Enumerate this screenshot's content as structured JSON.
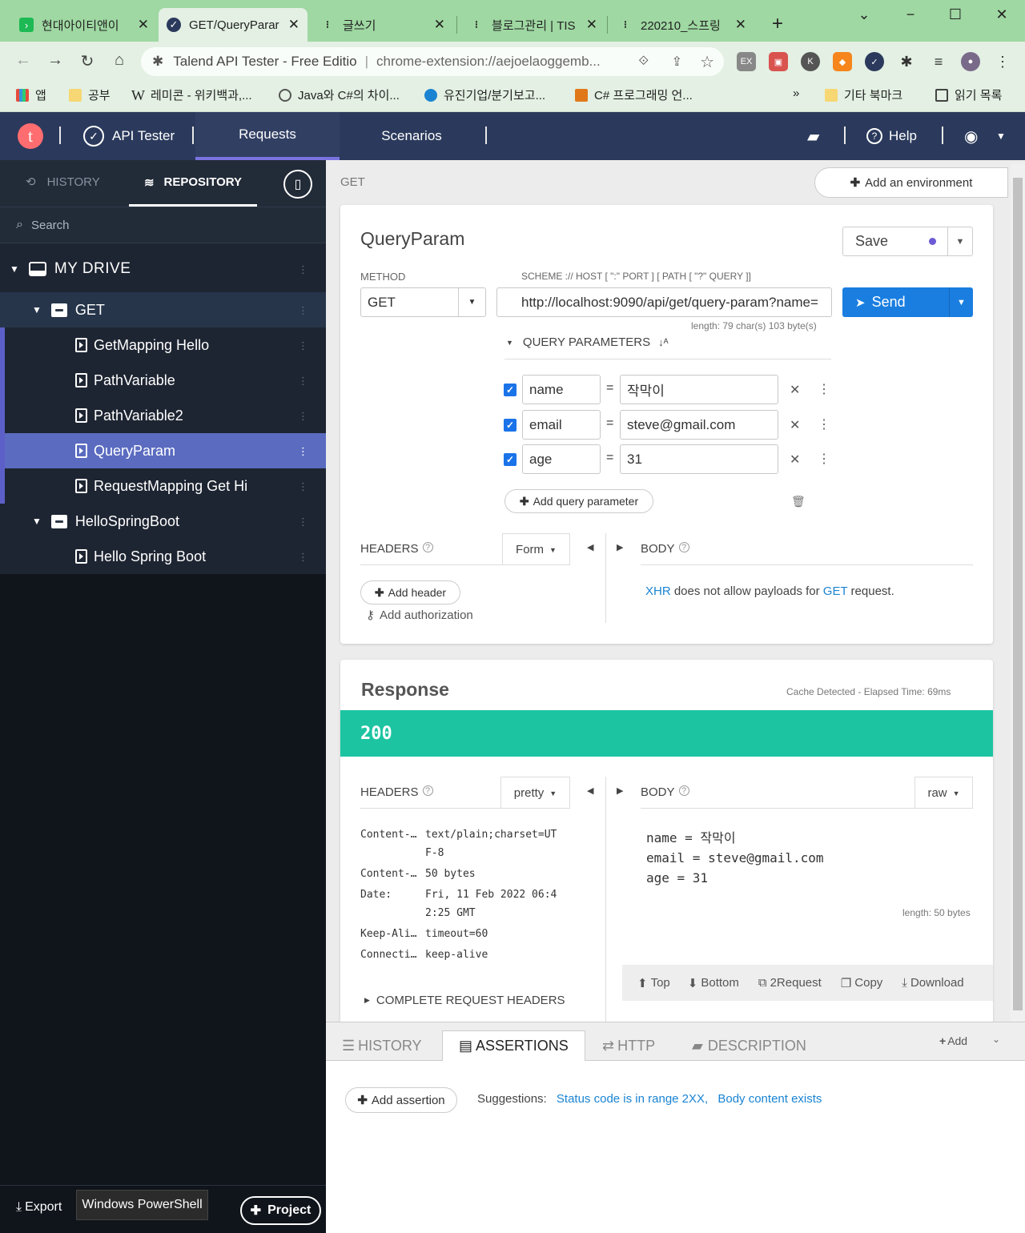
{
  "browser": {
    "tabs": [
      {
        "label": "현대아이티앤이",
        "icon": "green-arrow-icon",
        "color": "#1db954"
      },
      {
        "label": "GET/QueryParar",
        "icon": "talend-check-icon",
        "color": "#2b3a5c"
      },
      {
        "label": "글쓰기",
        "icon": "tistory-icon",
        "color": "#222"
      },
      {
        "label": "블로그관리 | TIS",
        "icon": "tistory-icon",
        "color": "#222"
      },
      {
        "label": "220210_스프링",
        "icon": "tistory-icon",
        "color": "#222"
      }
    ],
    "new_tab": "+",
    "window_controls": {
      "minimize": "−",
      "maximize": "☐",
      "close": "✕",
      "tab_list": "⌄"
    },
    "omnibox": {
      "site": "Talend API Tester - Free Editio",
      "url": "chrome-extension://aejoelaoggemb..."
    },
    "bookmarks": [
      {
        "label": "앱"
      },
      {
        "label": "공부"
      },
      {
        "label": "레미콘 - 위키백과,..."
      },
      {
        "label": "Java와 C#의 차이..."
      },
      {
        "label": "유진기업/분기보고..."
      },
      {
        "label": "C# 프로그래밍 언..."
      }
    ],
    "bookmarks_more": "»",
    "bookmarks_right": [
      {
        "label": "기타 북마크"
      },
      {
        "label": "읽기 목록"
      }
    ]
  },
  "app_header": {
    "logo": "t",
    "product": "API Tester",
    "nav": [
      {
        "label": "Requests"
      },
      {
        "label": "Scenarios"
      }
    ],
    "help": "Help"
  },
  "sidebar": {
    "tabs": [
      {
        "label": "HISTORY"
      },
      {
        "label": "REPOSITORY"
      }
    ],
    "search_placeholder": "Search",
    "drive": "MY DRIVE",
    "tree": [
      {
        "label": "GET",
        "type": "folder"
      },
      {
        "label": "GetMapping Hello",
        "type": "request"
      },
      {
        "label": "PathVariable",
        "type": "request"
      },
      {
        "label": "PathVariable2",
        "type": "request"
      },
      {
        "label": "QueryParam",
        "type": "request",
        "selected": true
      },
      {
        "label": "RequestMapping Get Hi",
        "type": "request"
      },
      {
        "label": "HelloSpringBoot",
        "type": "folder"
      },
      {
        "label": "Hello Spring Boot",
        "type": "request"
      }
    ],
    "footer": {
      "export": "Export",
      "tooltip": "Windows PowerShell",
      "project": "Project"
    }
  },
  "request": {
    "breadcrumb": "GET",
    "add_environment": "Add an environment",
    "title": "QueryParam",
    "save": "Save",
    "method_label": "METHOD",
    "method": "GET",
    "scheme_label": "SCHEME :// HOST [ \":\" PORT ] [ PATH [ \"?\" QUERY ]]",
    "url": "http://localhost:9090/api/get/query-param?name=",
    "send": "Send",
    "length": "length: 79 char(s) 103 byte(s)",
    "query_label": "QUERY PARAMETERS",
    "params": [
      {
        "key": "name",
        "value": "작막이"
      },
      {
        "key": "email",
        "value": "steve@gmail.com"
      },
      {
        "key": "age",
        "value": "31"
      }
    ],
    "equals": "=",
    "add_query_param": "Add query parameter",
    "headers_label": "HEADERS",
    "headers_mode": "Form",
    "add_header": "Add header",
    "add_authorization": "Add authorization",
    "body_label": "BODY",
    "body_note": {
      "xhr": "XHR",
      "middle": " does not allow payloads for ",
      "get": "GET",
      "end": " request."
    }
  },
  "response": {
    "title": "Response",
    "meta": "Cache Detected - Elapsed Time: 69ms",
    "status": "200",
    "status_color": "#1cc4a2",
    "headers_label": "HEADERS",
    "headers_mode": "pretty",
    "headers": [
      {
        "k": "Content-…",
        "v1": "text/plain;charset=UT",
        "v2": "F-8"
      },
      {
        "k": "Content-…",
        "v1": "50 bytes",
        "v2": ""
      },
      {
        "k": "Date:",
        "v1": "Fri, 11 Feb 2022 06:4",
        "v2": "2:25 GMT"
      },
      {
        "k": "Keep-Ali…",
        "v1": "timeout=60",
        "v2": ""
      },
      {
        "k": "Connecti…",
        "v1": "keep-alive",
        "v2": ""
      }
    ],
    "complete_headers": "COMPLETE REQUEST HEADERS",
    "body_label": "BODY",
    "body_mode": "raw",
    "body_lines": [
      "name = 작막이",
      "email = steve@gmail.com",
      "age = 31"
    ],
    "body_length": "length: 50 bytes",
    "actions": [
      {
        "label": "Top",
        "icon": "arrow-up-circle-icon"
      },
      {
        "label": "Bottom",
        "icon": "arrow-down-circle-icon"
      },
      {
        "label": "2Request",
        "icon": "copy-request-icon"
      },
      {
        "label": "Copy",
        "icon": "copy-icon"
      },
      {
        "label": "Download",
        "icon": "download-icon"
      }
    ]
  },
  "bottom_panel": {
    "tabs": [
      {
        "label": "HISTORY"
      },
      {
        "label": "ASSERTIONS",
        "active": true
      },
      {
        "label": "HTTP"
      },
      {
        "label": "DESCRIPTION"
      }
    ],
    "add": "Add",
    "add_assertion": "Add assertion",
    "suggestions_label": "Suggestions:",
    "suggestions": [
      "Status code is in range 2XX,",
      "Body content exists"
    ]
  }
}
